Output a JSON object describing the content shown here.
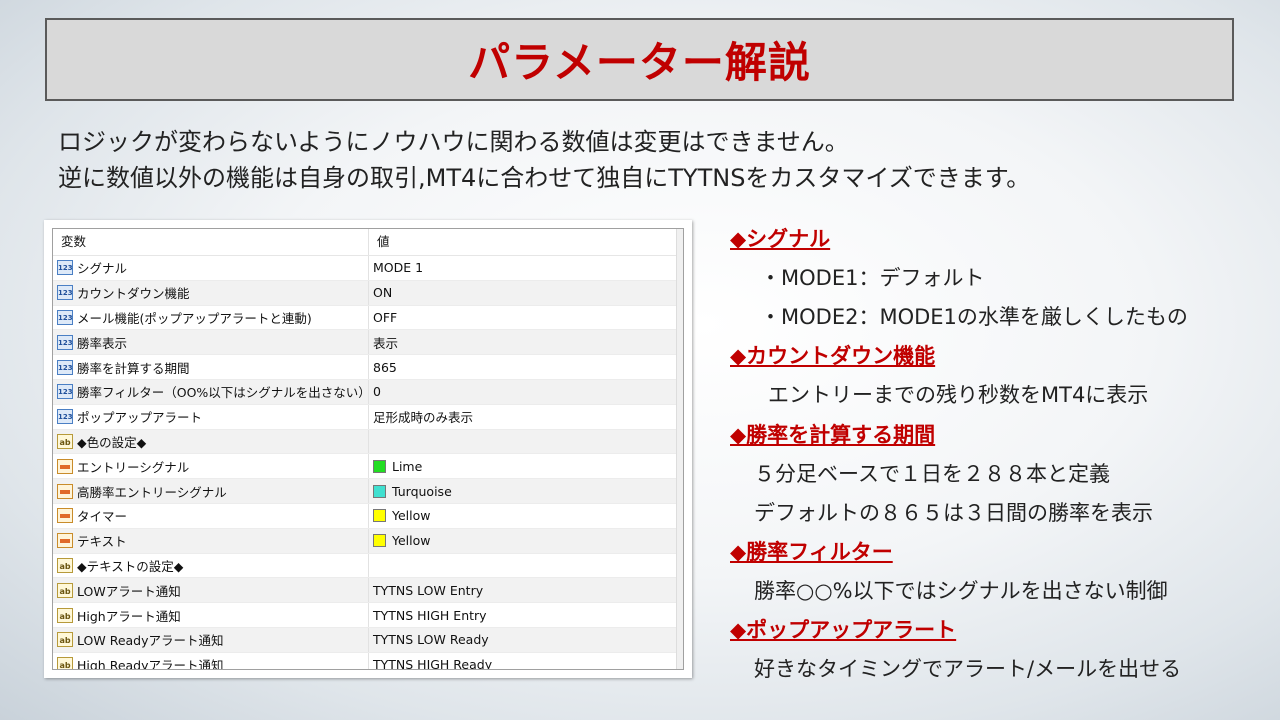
{
  "title": "パラメーター解説",
  "intro": [
    "ロジックが変わらないようにノウハウに関わる数値は変更はできません。",
    "逆に数値以外の機能は自身の取引,MT4に合わせて独自にTYTNSをカスタマイズできます。"
  ],
  "table": {
    "header": {
      "variable": "変数",
      "value": "値"
    },
    "rows": [
      {
        "icon": "123",
        "name": "シグナル",
        "value": "MODE 1"
      },
      {
        "icon": "123",
        "name": "カウントダウン機能",
        "value": "ON"
      },
      {
        "icon": "123",
        "name": "メール機能(ポップアップアラートと連動)",
        "value": "OFF"
      },
      {
        "icon": "123",
        "name": "勝率表示",
        "value": "表示"
      },
      {
        "icon": "123",
        "name": "勝率を計算する期間",
        "value": "865"
      },
      {
        "icon": "123",
        "name": "勝率フィルター（OO%以下はシグナルを出さない）",
        "value": "0"
      },
      {
        "icon": "123",
        "name": "ポップアップアラート",
        "value": "足形成時のみ表示"
      },
      {
        "icon": "ab",
        "name": "◆色の設定◆",
        "value": ""
      },
      {
        "icon": "color",
        "name": "エントリーシグナル",
        "value": "Lime",
        "swatch": "#22dd22"
      },
      {
        "icon": "color",
        "name": "高勝率エントリーシグナル",
        "value": "Turquoise",
        "swatch": "#40e0d0"
      },
      {
        "icon": "color",
        "name": "タイマー",
        "value": "Yellow",
        "swatch": "#ffff00"
      },
      {
        "icon": "color",
        "name": "テキスト",
        "value": "Yellow",
        "swatch": "#ffff00"
      },
      {
        "icon": "ab",
        "name": "◆テキストの設定◆",
        "value": ""
      },
      {
        "icon": "ab",
        "name": "LOWアラート通知",
        "value": "TYTNS LOW Entry"
      },
      {
        "icon": "ab",
        "name": "Highアラート通知",
        "value": "TYTNS HIGH Entry"
      },
      {
        "icon": "ab",
        "name": "LOW Readyアラート通知",
        "value": "TYTNS LOW Ready"
      },
      {
        "icon": "ab",
        "name": "High Readyアラート通知",
        "value": "TYTNS HIGH Ready"
      }
    ]
  },
  "explanations": {
    "signal": {
      "heading": "◆シグナル",
      "lines": [
        "・MODE1：デフォルト",
        "・MODE2：MODE1の水準を厳しくしたもの"
      ]
    },
    "countdown": {
      "heading": "◆カウントダウン機能",
      "lines": [
        "エントリーまでの残り秒数をMT4に表示"
      ]
    },
    "period": {
      "heading": "◆勝率を計算する期間",
      "lines": [
        "５分足ベースで１日を２８８本と定義",
        "デフォルトの８６５は３日間の勝率を表示"
      ]
    },
    "filter": {
      "heading": "◆勝率フィルター",
      "lines": [
        "勝率○○%以下ではシグナルを出さない制御"
      ]
    },
    "popup": {
      "heading": "◆ポップアップアラート",
      "lines": [
        "好きなタイミングでアラート/メールを出せる"
      ]
    }
  },
  "colors": {
    "title": "#c00000",
    "heading": "#c00000",
    "title_bg": "#d9d9d9"
  }
}
